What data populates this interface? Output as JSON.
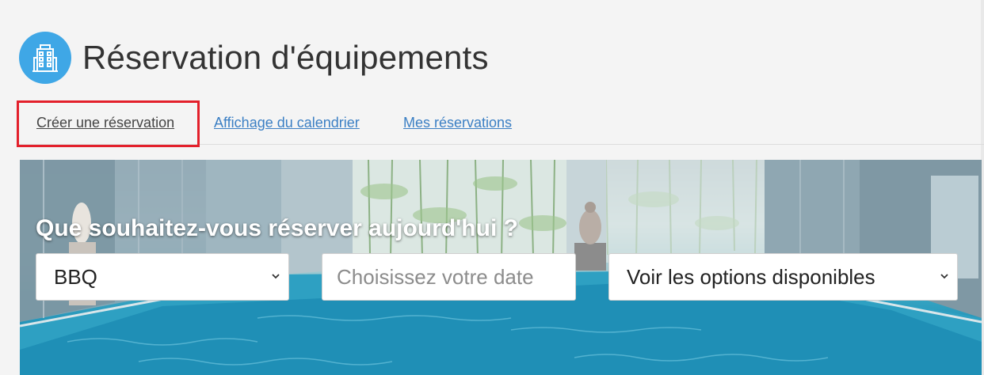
{
  "header": {
    "icon": "building-icon",
    "title": "Réservation d'équipements"
  },
  "tabs": [
    {
      "label": "Créer une réservation",
      "active": true
    },
    {
      "label": "Affichage du calendrier",
      "active": false
    },
    {
      "label": "Mes réservations",
      "active": false
    }
  ],
  "hero": {
    "question": "Que souhaitez-vous réserver aujourd'hui ?",
    "activity_select": {
      "value": "BBQ",
      "icon": "chevron-down-icon"
    },
    "date_input": {
      "placeholder": "Choisissez votre date"
    },
    "options_select": {
      "value": "Voir les options disponibles",
      "icon": "chevron-down-icon"
    }
  },
  "colors": {
    "page_bg": "#f4f4f4",
    "icon_circle": "#3fa7e6",
    "link": "#3b7fc4",
    "highlight": "#e3202b",
    "title": "#333333"
  }
}
